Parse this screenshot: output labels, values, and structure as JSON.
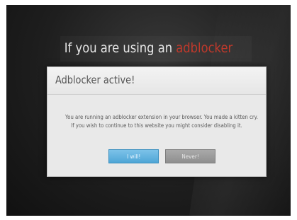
{
  "background": {
    "headline_prefix": "If you are using an",
    "headline_accent": "adblocker",
    "accent_color": "#c0392b"
  },
  "dialog": {
    "title": "Adblocker active!",
    "message_line1": "You are running an adblocker extension in your browser. You made a kitten cry.",
    "message_line2": "If you wish to continue to this website you might consider disabling it.",
    "primary_button_label": "I will!",
    "secondary_button_label": "Never!",
    "primary_color": "#5aafdd",
    "secondary_color": "#999999"
  }
}
